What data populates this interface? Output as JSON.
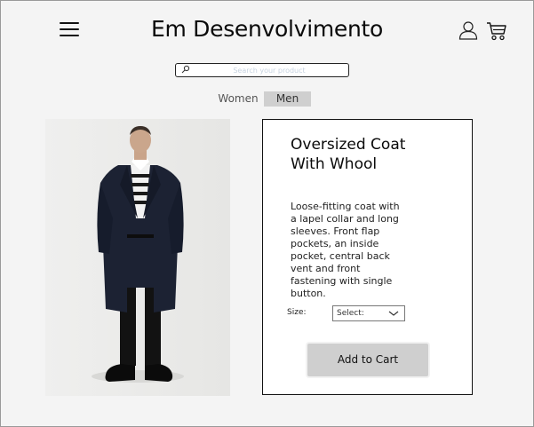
{
  "header": {
    "brand": "Em Desenvolvimento",
    "menu_icon": "hamburger-menu-icon",
    "user_icon": "user-icon",
    "cart_icon": "shopping-cart-icon"
  },
  "search": {
    "placeholder": "Search your product",
    "value": "",
    "icon": "search-icon"
  },
  "tabs": [
    {
      "label": "Women",
      "active": false
    },
    {
      "label": "Men",
      "active": true
    }
  ],
  "product": {
    "title": "Oversized Coat With Whool",
    "description": "Loose-fitting coat with a lapel collar and long sleeves. Front flap pockets, an inside pocket, central back vent and front fastening with single button.",
    "size_label": "Size:",
    "size_selected": "Select:",
    "add_to_cart": "Add to Cart"
  },
  "colors": {
    "background": "#f4f4f4",
    "active_tab": "#cfcfcf",
    "button": "#cfcfcf",
    "coat": "#1c2233"
  }
}
